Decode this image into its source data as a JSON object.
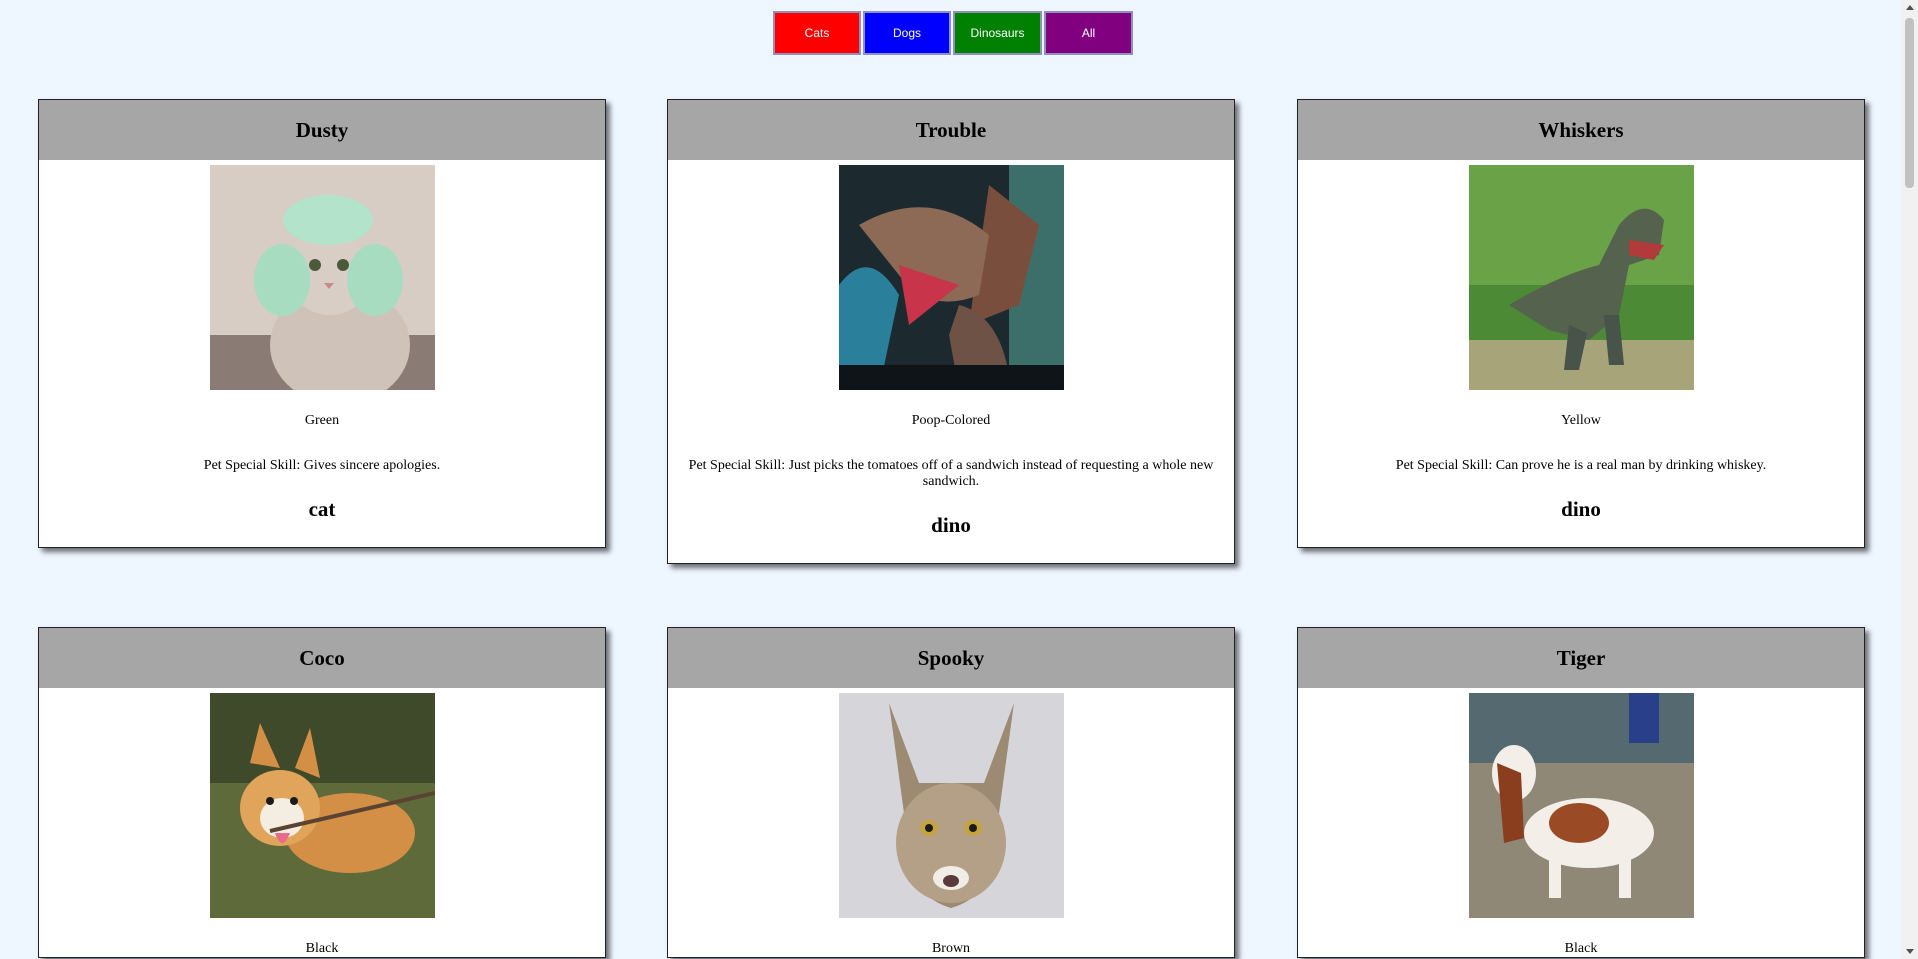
{
  "filters": [
    {
      "label": "Cats",
      "color": "#ff0000"
    },
    {
      "label": "Dogs",
      "color": "#0000ff"
    },
    {
      "label": "Dinosaurs",
      "color": "#008000"
    },
    {
      "label": "All",
      "color": "#800080"
    }
  ],
  "pets": [
    {
      "name": "Dusty",
      "color": "Green",
      "skill": "Pet Special Skill: Gives sincere apologies.",
      "type": "cat",
      "image": "cat-with-green-buns-photo"
    },
    {
      "name": "Trouble",
      "color": "Poop-Colored",
      "skill": "Pet Special Skill: Just picks the tomatoes off of a sandwich instead of requesting a whole new sandwich.",
      "type": "dino",
      "image": "spinosaurus-exhibit-photo"
    },
    {
      "name": "Whiskers",
      "color": "Yellow",
      "skill": "Pet Special Skill: Can prove he is a real man by drinking whiskey.",
      "type": "dino",
      "image": "t-rex-in-forest-photo"
    },
    {
      "name": "Coco",
      "color": "Black",
      "skill": "",
      "type": "",
      "image": "corgi-with-stick-photo"
    },
    {
      "name": "Spooky",
      "color": "Brown",
      "skill": "",
      "type": "",
      "image": "maine-coon-cat-photo"
    },
    {
      "name": "Tiger",
      "color": "Black",
      "skill": "",
      "type": "",
      "image": "basset-hound-photo"
    }
  ]
}
